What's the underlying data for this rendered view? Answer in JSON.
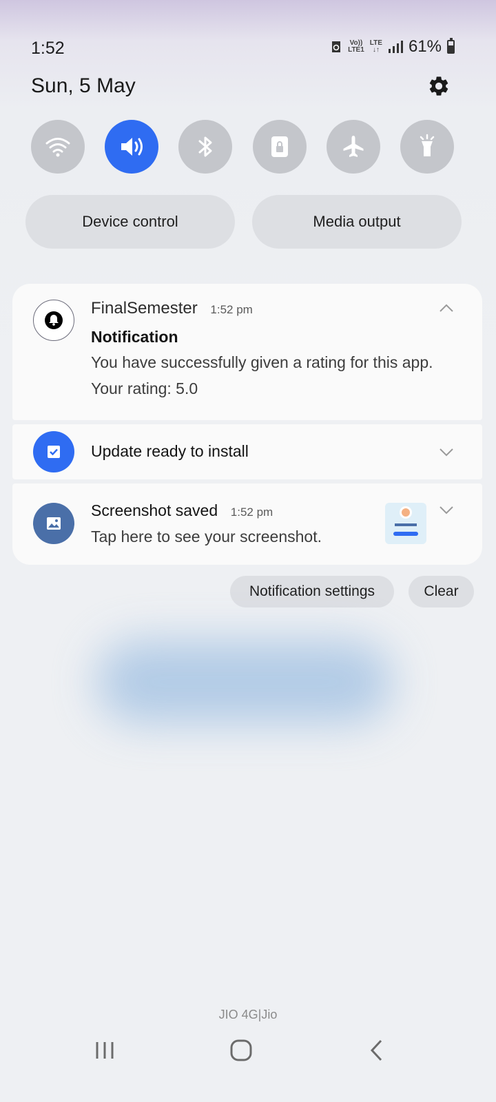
{
  "status_bar": {
    "time": "1:52",
    "volte_top": "Vo))",
    "volte_bottom": "LTE1",
    "lte": "LTE",
    "battery_percent": "61%",
    "battery_level": 0.61
  },
  "header": {
    "date": "Sun, 5 May"
  },
  "quick_toggles": [
    {
      "name": "wifi",
      "on": false
    },
    {
      "name": "sound",
      "on": true
    },
    {
      "name": "bluetooth",
      "on": false
    },
    {
      "name": "lock",
      "on": false
    },
    {
      "name": "airplane",
      "on": false
    },
    {
      "name": "flashlight",
      "on": false
    }
  ],
  "quick_panel_buttons": {
    "device_control": "Device control",
    "media_output": "Media output"
  },
  "notifications": [
    {
      "app": "FinalSemester",
      "time": "1:52 pm",
      "title": "Notification",
      "body": "You have successfully given a rating for this app. Your rating: 5.0"
    },
    {
      "title": "Update ready to install"
    },
    {
      "title": "Screenshot saved",
      "time": "1:52 pm",
      "body": "Tap here to see your screenshot."
    }
  ],
  "notification_actions": {
    "settings": "Notification settings",
    "clear": "Clear"
  },
  "carrier": "JIO 4G|Jio",
  "colors": {
    "accent": "#2f6cf2",
    "toggle_off": "#c4c6cb",
    "update_icon": "#2f6cf2",
    "screenshot_icon": "#4a6fa8"
  }
}
